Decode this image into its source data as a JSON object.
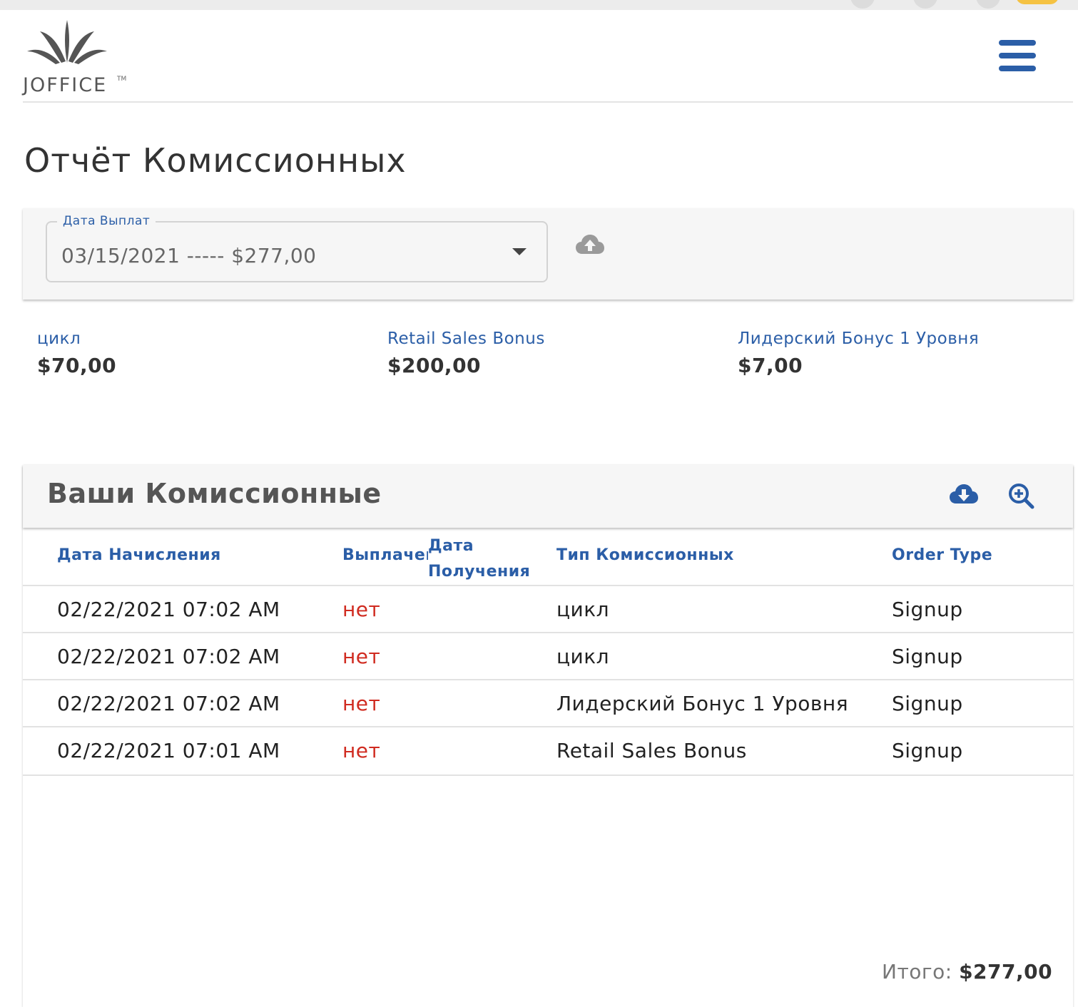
{
  "brand": {
    "logo_text": "JOFFICE",
    "trademark": "TM",
    "accent_color": "#2b5ea7",
    "alert_color": "#d02b20"
  },
  "page": {
    "title": "Отчёт Комиссионных"
  },
  "filter": {
    "label": "Дата Выплат",
    "selected": "03/15/2021 ----- $277,00",
    "upload_icon": "cloud-upload-icon"
  },
  "summary": [
    {
      "label": "цикл",
      "amount": "$70,00"
    },
    {
      "label": "Retail Sales Bonus",
      "amount": "$200,00"
    },
    {
      "label": "Лидерский Бонус 1 Уровня",
      "amount": "$7,00"
    }
  ],
  "commissions": {
    "title": "Ваши Комиссионные",
    "download_icon": "cloud-download-icon",
    "zoom_icon": "zoom-in-icon",
    "columns": {
      "accrual_date": "Дата Начисления",
      "paid": "Выплачен",
      "received_date": "Дата Получения",
      "commission_type": "Тип Комиссионных",
      "order_type": "Order Type"
    },
    "rows": [
      {
        "accrual_date": "02/22/2021 07:02 AM",
        "paid": "нет",
        "received_date": "",
        "commission_type": "цикл",
        "order_type": "Signup"
      },
      {
        "accrual_date": "02/22/2021 07:02 AM",
        "paid": "нет",
        "received_date": "",
        "commission_type": "цикл",
        "order_type": "Signup"
      },
      {
        "accrual_date": "02/22/2021 07:02 AM",
        "paid": "нет",
        "received_date": "",
        "commission_type": "Лидерский Бонус 1 Уровня",
        "order_type": "Signup"
      },
      {
        "accrual_date": "02/22/2021 07:01 AM",
        "paid": "нет",
        "received_date": "",
        "commission_type": "Retail Sales Bonus",
        "order_type": "Signup"
      }
    ],
    "total_label": "Итого:",
    "total_value": "$277,00"
  }
}
